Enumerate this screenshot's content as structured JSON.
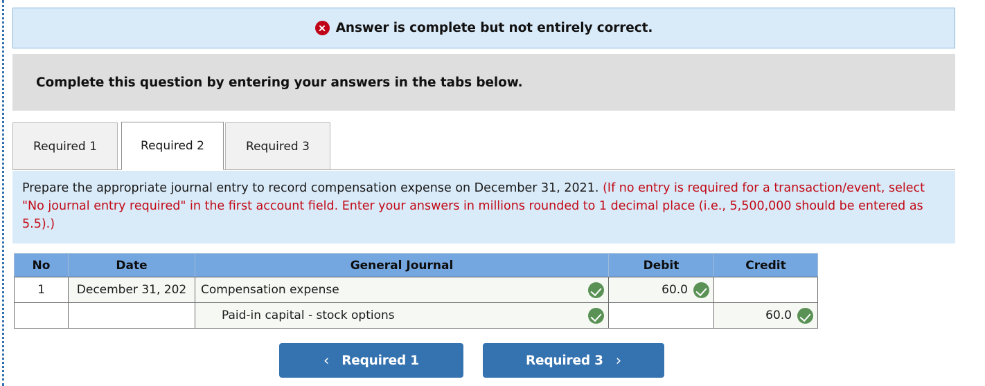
{
  "alert": {
    "icon": "error-circle-x-icon",
    "message": "Answer is complete but not entirely correct."
  },
  "instruction_bar": {
    "text": "Complete this question by entering your answers in the tabs below."
  },
  "tabs": {
    "active_index": 1,
    "items": [
      {
        "label": "Required 1"
      },
      {
        "label": "Required 2"
      },
      {
        "label": "Required 3"
      }
    ]
  },
  "instruction_panel": {
    "black_text": "Prepare the appropriate journal entry to record compensation expense on December 31, 2021.",
    "red_text": "(If no entry is required for a transaction/event, select \"No journal entry required\" in the first account field. Enter your answers in millions rounded to 1 decimal place (i.e., 5,500,000 should be entered as 5.5).)"
  },
  "journal_table": {
    "headers": {
      "no": "No",
      "date": "Date",
      "general_journal": "General Journal",
      "debit": "Debit",
      "credit": "Credit"
    },
    "rows": [
      {
        "no": "1",
        "date": "December 31, 202",
        "account": "Compensation expense",
        "account_status": "correct-check-icon",
        "debit": "60.0",
        "debit_status": "correct-check-icon",
        "credit": "",
        "credit_status": ""
      },
      {
        "no": "",
        "date": "",
        "account": "Paid-in capital - stock options",
        "account_status": "correct-check-icon",
        "debit": "",
        "debit_status": "",
        "credit": "60.0",
        "credit_status": "correct-check-icon"
      }
    ]
  },
  "navigation": {
    "prev_chevron": "‹",
    "prev_label": "Required 1",
    "next_label": "Required 3",
    "next_chevron": "›"
  },
  "colors": {
    "alert_bg": "#d9eaf8",
    "alert_border": "#8ab4d8",
    "error_red": "#c00418",
    "gray_bar": "#dedede",
    "instruction_red": "#c20a16",
    "table_header_blue": "#74a6e0",
    "check_green": "#5a9155",
    "button_blue": "#3572b0",
    "rail_blue": "#2f6fad"
  }
}
